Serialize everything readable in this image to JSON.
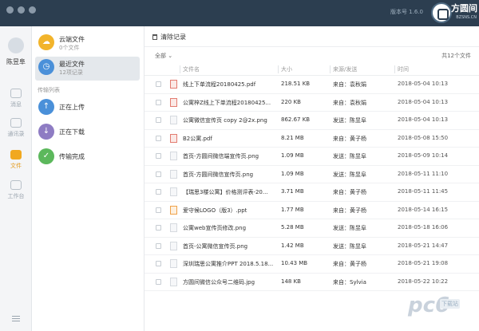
{
  "titlebar": {
    "version": "版本号 1.6.0",
    "logo_text": "方圆间",
    "logo_sub": "BZSNS.CN"
  },
  "rail": {
    "user_name": "陈昱阜",
    "items": [
      {
        "label": "消息",
        "icon": "chat-icon"
      },
      {
        "label": "通讯录",
        "icon": "contacts-icon"
      },
      {
        "label": "文件",
        "icon": "folder-icon",
        "active": true
      },
      {
        "label": "工作台",
        "icon": "grid-icon"
      }
    ],
    "accent": "#f1a81f"
  },
  "nav": {
    "cloud": {
      "title": "云端文件",
      "sub": "0个文件",
      "color": "#f2b42b"
    },
    "recent": {
      "title": "最近文件",
      "sub": "12项记录",
      "color": "#4a90d9"
    },
    "section_title": "传输列表",
    "upload": {
      "title": "正在上传",
      "color": "#4a90d9"
    },
    "download": {
      "title": "正在下载",
      "color": "#8e7cc3"
    },
    "done": {
      "title": "传输完成",
      "color": "#5cb85c"
    }
  },
  "main": {
    "clear_label": "清除记录",
    "filter_label": "全部",
    "total_label": "共12个文件",
    "columns": {
      "name": "文件名",
      "size": "大小",
      "source": "来源/发送",
      "time": "时间"
    },
    "files": [
      {
        "name": "线上下单流程20180425.pdf",
        "size": "218.51 KB",
        "source": "来自：袁秋娟",
        "time": "2018-05-04 10:13",
        "type": "pdf"
      },
      {
        "name": "公寓梓Z线上下单流程20180425...",
        "size": "220 KB",
        "source": "来自：袁秋娟",
        "time": "2018-05-04 10:13",
        "type": "pdf"
      },
      {
        "name": "公寓微信宣传页 copy 2@2x.png",
        "size": "862.67 KB",
        "source": "发送：陈昱阜",
        "time": "2018-05-04 10:13",
        "type": "img"
      },
      {
        "name": "B2公寓.pdf",
        "size": "8.21 MB",
        "source": "来自：黄子杨",
        "time": "2018-05-08 15:50",
        "type": "pdf"
      },
      {
        "name": "首页-方圆间微信端宣传页.png",
        "size": "1.09 MB",
        "source": "发送：陈昱阜",
        "time": "2018-05-09 10:14",
        "type": "img"
      },
      {
        "name": "首页-方圆间微信宣传页.png",
        "size": "1.09 MB",
        "source": "发送：陈昱阜",
        "time": "2018-05-11 11:10",
        "type": "img"
      },
      {
        "name": "【瑞思3楼公寓】价格测评表-20...",
        "size": "3.71 MB",
        "source": "来自：黄子杨",
        "time": "2018-05-11 11:45",
        "type": "img"
      },
      {
        "name": "爱守候LOGO（版3）.ppt",
        "size": "1.77 MB",
        "source": "来自：黄子杨",
        "time": "2018-05-14 16:15",
        "type": "ppt"
      },
      {
        "name": "公寓web宣传页修改.png",
        "size": "5.28 MB",
        "source": "发送：陈昱阜",
        "time": "2018-05-18 16:06",
        "type": "img"
      },
      {
        "name": "首页-公寓微信宣传页.png",
        "size": "1.42 MB",
        "source": "发送：陈昱阜",
        "time": "2018-05-21 14:47",
        "type": "img"
      },
      {
        "name": "深圳瑞思公寓推介PPT 2018.5.18...",
        "size": "10.43 MB",
        "source": "来自：黄子杨",
        "time": "2018-05-21 19:08",
        "type": "img"
      },
      {
        "name": "方圆间微信公众号二维码.jpg",
        "size": "148 KB",
        "source": "来自：Sylvia",
        "time": "2018-05-22 10:22",
        "type": "img"
      }
    ]
  },
  "watermark": {
    "main": "pc6",
    "badge": "下载站"
  }
}
